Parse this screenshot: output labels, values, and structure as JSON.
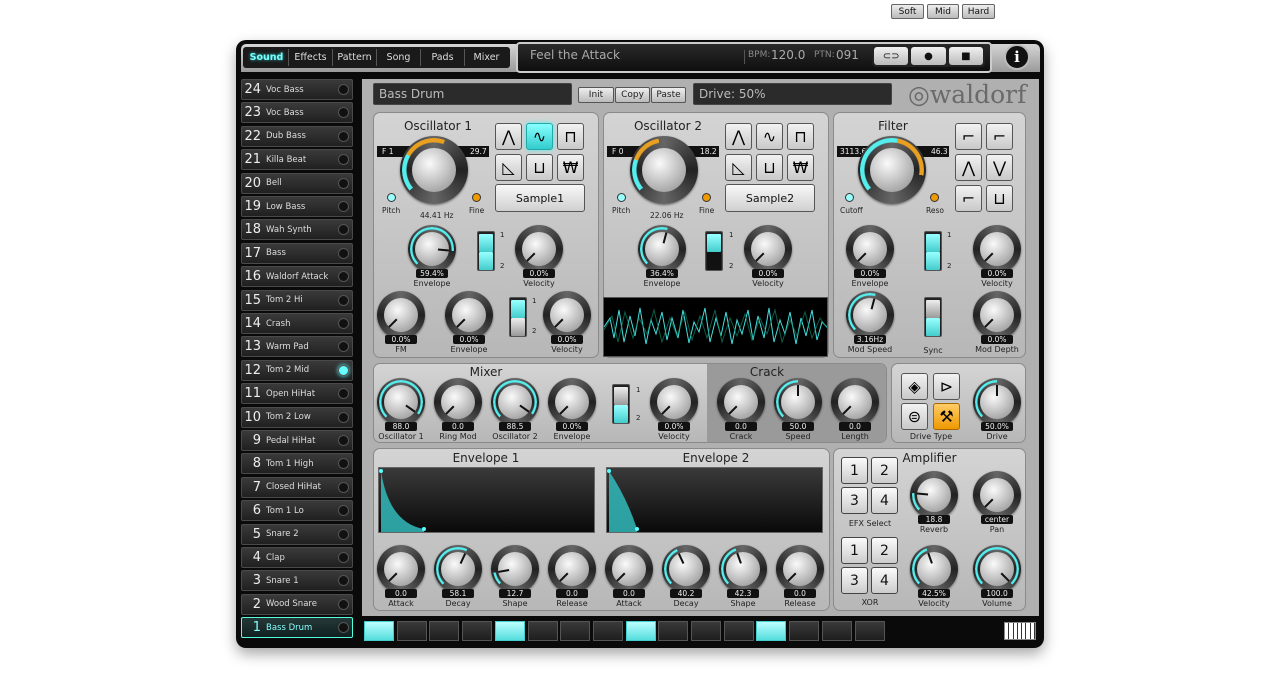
{
  "tabs": [
    "Sound",
    "Effects",
    "Pattern",
    "Song",
    "Pads",
    "Mixer"
  ],
  "title": "Feel the Attack",
  "bpm_label": "BPM:",
  "bpm": "120.0",
  "ptn_label": "PTN:",
  "ptn": "091",
  "sound_name": "Bass Drum",
  "init": "Init",
  "copy": "Copy",
  "paste": "Paste",
  "drive_text": "Drive: 50%",
  "logo": "waldorf",
  "instruments": [
    {
      "n": "24",
      "l": "Voc Bass"
    },
    {
      "n": "23",
      "l": "Voc Bass"
    },
    {
      "n": "22",
      "l": "Dub Bass"
    },
    {
      "n": "21",
      "l": "Killa Beat"
    },
    {
      "n": "20",
      "l": "Bell"
    },
    {
      "n": "19",
      "l": "Low Bass"
    },
    {
      "n": "18",
      "l": "Wah Synth"
    },
    {
      "n": "17",
      "l": "Bass"
    },
    {
      "n": "16",
      "l": "Waldorf Attack"
    },
    {
      "n": "15",
      "l": "Tom 2 Hi"
    },
    {
      "n": "14",
      "l": "Crash"
    },
    {
      "n": "13",
      "l": "Warm Pad"
    },
    {
      "n": "12",
      "l": "Tom 2 Mid"
    },
    {
      "n": "11",
      "l": "Open HiHat"
    },
    {
      "n": "10",
      "l": "Tom 2 Low"
    },
    {
      "n": "9",
      "l": "Pedal HiHat"
    },
    {
      "n": "8",
      "l": "Tom 1 High"
    },
    {
      "n": "7",
      "l": "Closed HiHat"
    },
    {
      "n": "6",
      "l": "Tom 1 Lo"
    },
    {
      "n": "5",
      "l": "Snare 2"
    },
    {
      "n": "4",
      "l": "Clap"
    },
    {
      "n": "3",
      "l": "Snare 1"
    },
    {
      "n": "2",
      "l": "Wood Snare"
    },
    {
      "n": "1",
      "l": "Bass Drum"
    }
  ],
  "osc1": {
    "title": "Oscillator 1",
    "range_lo": "F 1",
    "range_hi": "29.7",
    "freq": "44.41 Hz",
    "pitch": "Pitch",
    "fine": "Fine",
    "sample": "Sample1",
    "env_val": "59.4%",
    "env": "Envelope",
    "vel_val": "0.0%",
    "vel": "Velocity",
    "fm_val": "0.0%",
    "fm": "FM",
    "env2_val": "0.0%",
    "env2": "Envelope",
    "vel2_val": "0.0%",
    "vel2": "Velocity"
  },
  "osc2": {
    "title": "Oscillator 2",
    "range_lo": "F 0",
    "range_hi": "18.2",
    "freq": "22.06 Hz",
    "pitch": "Pitch",
    "fine": "Fine",
    "sample": "Sample2",
    "env_val": "36.4%",
    "env": "Envelope",
    "vel_val": "0.0%",
    "vel": "Velocity"
  },
  "filter": {
    "title": "Filter",
    "range_lo": "3113.6",
    "range_hi": "46.3",
    "cutoff": "Cutoff",
    "reso": "Reso",
    "env_val": "0.0%",
    "env": "Envelope",
    "vel_val": "0.0%",
    "vel": "Velocity",
    "mspeed_val": "3.16Hz",
    "mspeed": "Mod Speed",
    "sync": "Sync",
    "mdepth_val": "0.0%",
    "mdepth": "Mod Depth"
  },
  "mixer": {
    "title": "Mixer",
    "k1v": "88.0",
    "k1": "Oscillator 1",
    "k2v": "0.0",
    "k2": "Ring Mod",
    "k3v": "88.5",
    "k3": "Oscillator 2",
    "k4v": "0.0%",
    "k4": "Envelope",
    "k5v": "0.0%",
    "k5": "Velocity"
  },
  "crack": {
    "title": "Crack",
    "k1v": "0.0",
    "k1": "Crack",
    "k2v": "50.0",
    "k2": "Speed",
    "k3v": "0.0",
    "k3": "Length"
  },
  "drive": {
    "type": "Drive Type",
    "val": "50.0%",
    "label": "Drive"
  },
  "env1": {
    "title": "Envelope 1",
    "av": "0.0",
    "a": "Attack",
    "dv": "58.1",
    "d": "Decay",
    "sv": "12.7",
    "s": "Shape",
    "rv": "0.0",
    "r": "Release"
  },
  "env2": {
    "title": "Envelope 2",
    "av": "0.0",
    "a": "Attack",
    "dv": "40.2",
    "d": "Decay",
    "sv": "42.3",
    "s": "Shape",
    "rv": "0.0",
    "r": "Release"
  },
  "amp": {
    "title": "Amplifier",
    "efx": "EFX Select",
    "xor": "XOR",
    "revv": "18.8",
    "rev": "Reverb",
    "panv": "center",
    "pan": "Pan",
    "velv": "42.5%",
    "vel": "Velocity",
    "volv": "100.0",
    "vol": "Volume"
  },
  "sw_1": "1",
  "sw_2": "2",
  "n1": "1",
  "n2": "2",
  "n3": "3",
  "n4": "4",
  "soft": "Soft",
  "mid": "Mid",
  "hard": "Hard",
  "colors": {
    "accent": "#55e0e0",
    "orange": "#f0a020"
  }
}
